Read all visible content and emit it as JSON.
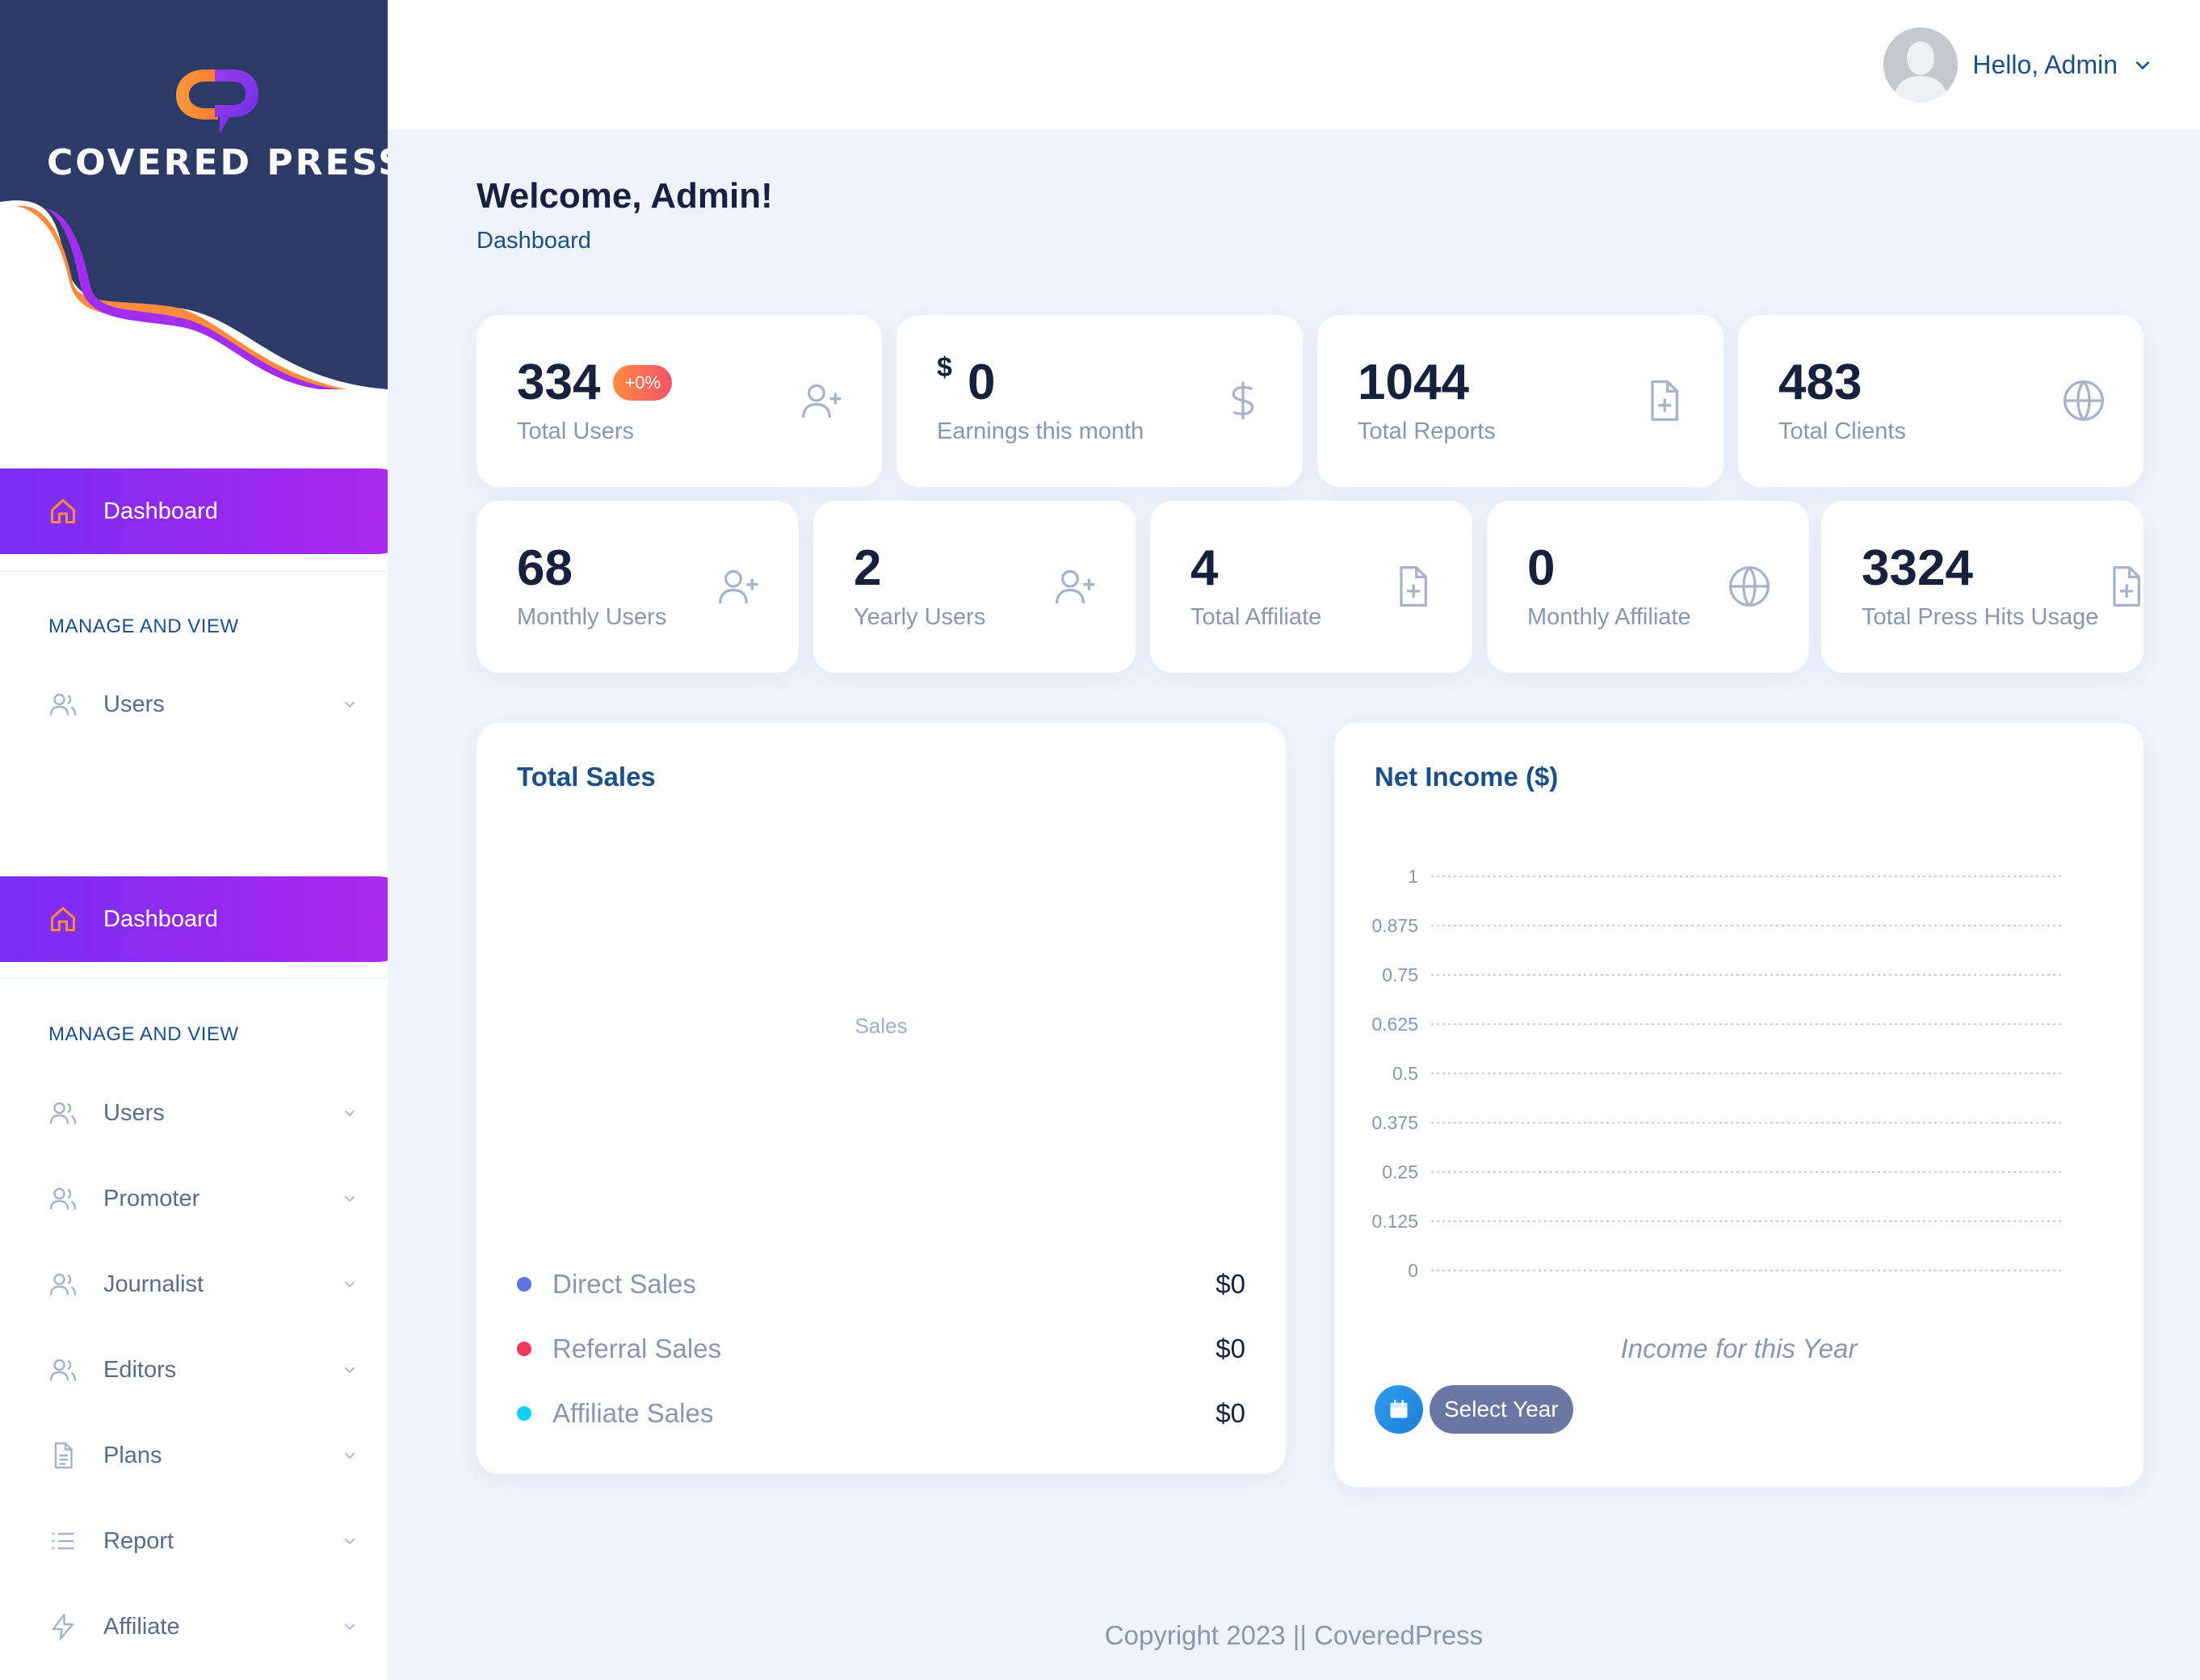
{
  "brand": {
    "name": "COVERED PRESS",
    "logo_icon": "covered-press-logo-icon"
  },
  "sidebar": {
    "block1": {
      "active": {
        "label": "Dashboard",
        "icon": "home-icon"
      },
      "section_title": "MANAGE AND VIEW",
      "items": [
        {
          "label": "Users",
          "icon": "users-icon"
        }
      ]
    },
    "block2": {
      "active": {
        "label": "Dashboard",
        "icon": "home-icon"
      },
      "section_title": "MANAGE AND VIEW",
      "items": [
        {
          "label": "Users",
          "icon": "users-icon"
        },
        {
          "label": "Promoter",
          "icon": "users-icon"
        },
        {
          "label": "Journalist",
          "icon": "users-icon"
        },
        {
          "label": "Editors",
          "icon": "users-icon"
        },
        {
          "label": "Plans",
          "icon": "document-icon"
        },
        {
          "label": "Report",
          "icon": "list-icon"
        },
        {
          "label": "Affiliate",
          "icon": "lightning-icon"
        }
      ]
    }
  },
  "header": {
    "greeting": "Hello, Admin",
    "avatar": "user-avatar",
    "chevron": "chevron-down-icon"
  },
  "page": {
    "title": "Welcome, Admin!",
    "breadcrumb": "Dashboard"
  },
  "stats_row1": [
    {
      "value": "334",
      "label": "Total Users",
      "badge": "+0%",
      "icon": "user-plus-icon"
    },
    {
      "currency": "$",
      "value": "0",
      "label": "Earnings this month",
      "icon": "dollar-icon"
    },
    {
      "value": "1044",
      "label": "Total Reports",
      "icon": "file-plus-icon"
    },
    {
      "value": "483",
      "label": "Total Clients",
      "icon": "globe-icon"
    }
  ],
  "stats_row2": [
    {
      "value": "68",
      "label": "Monthly Users",
      "icon": "user-plus-icon"
    },
    {
      "value": "2",
      "label": "Yearly Users",
      "icon": "user-plus-icon"
    },
    {
      "value": "4",
      "label": "Total Affiliate",
      "icon": "file-plus-icon"
    },
    {
      "value": "0",
      "label": "Monthly Affiliate",
      "icon": "globe-icon"
    },
    {
      "value": "3324",
      "label": "Total Press Hits Usage",
      "icon": "file-plus-icon"
    }
  ],
  "total_sales": {
    "title": "Total Sales",
    "placeholder": "Sales",
    "legend": [
      {
        "name": "Direct Sales",
        "amount": "$0",
        "color": "#5e72e4"
      },
      {
        "name": "Referral Sales",
        "amount": "$0",
        "color": "#f5365c"
      },
      {
        "name": "Affiliate Sales",
        "amount": "$0",
        "color": "#11cdef"
      }
    ]
  },
  "net_income": {
    "title": "Net Income ($)",
    "caption": "Income for this Year",
    "select_year_label": "Select Year",
    "calendar_icon": "calendar-icon"
  },
  "chart_data": {
    "type": "line",
    "title": "Net Income ($)",
    "xlabel": "",
    "ylabel": "",
    "ylim": [
      0,
      1
    ],
    "yticks": [
      "1",
      "0.875",
      "0.75",
      "0.625",
      "0.5",
      "0.375",
      "0.25",
      "0.125",
      "0"
    ],
    "grid": true,
    "series": []
  },
  "footer": {
    "text": "Copyright 2023 || CoveredPress"
  },
  "colors": {
    "accent": "#8a2be2",
    "brand_navy": "#2c3a66",
    "link": "#1b4f85"
  }
}
